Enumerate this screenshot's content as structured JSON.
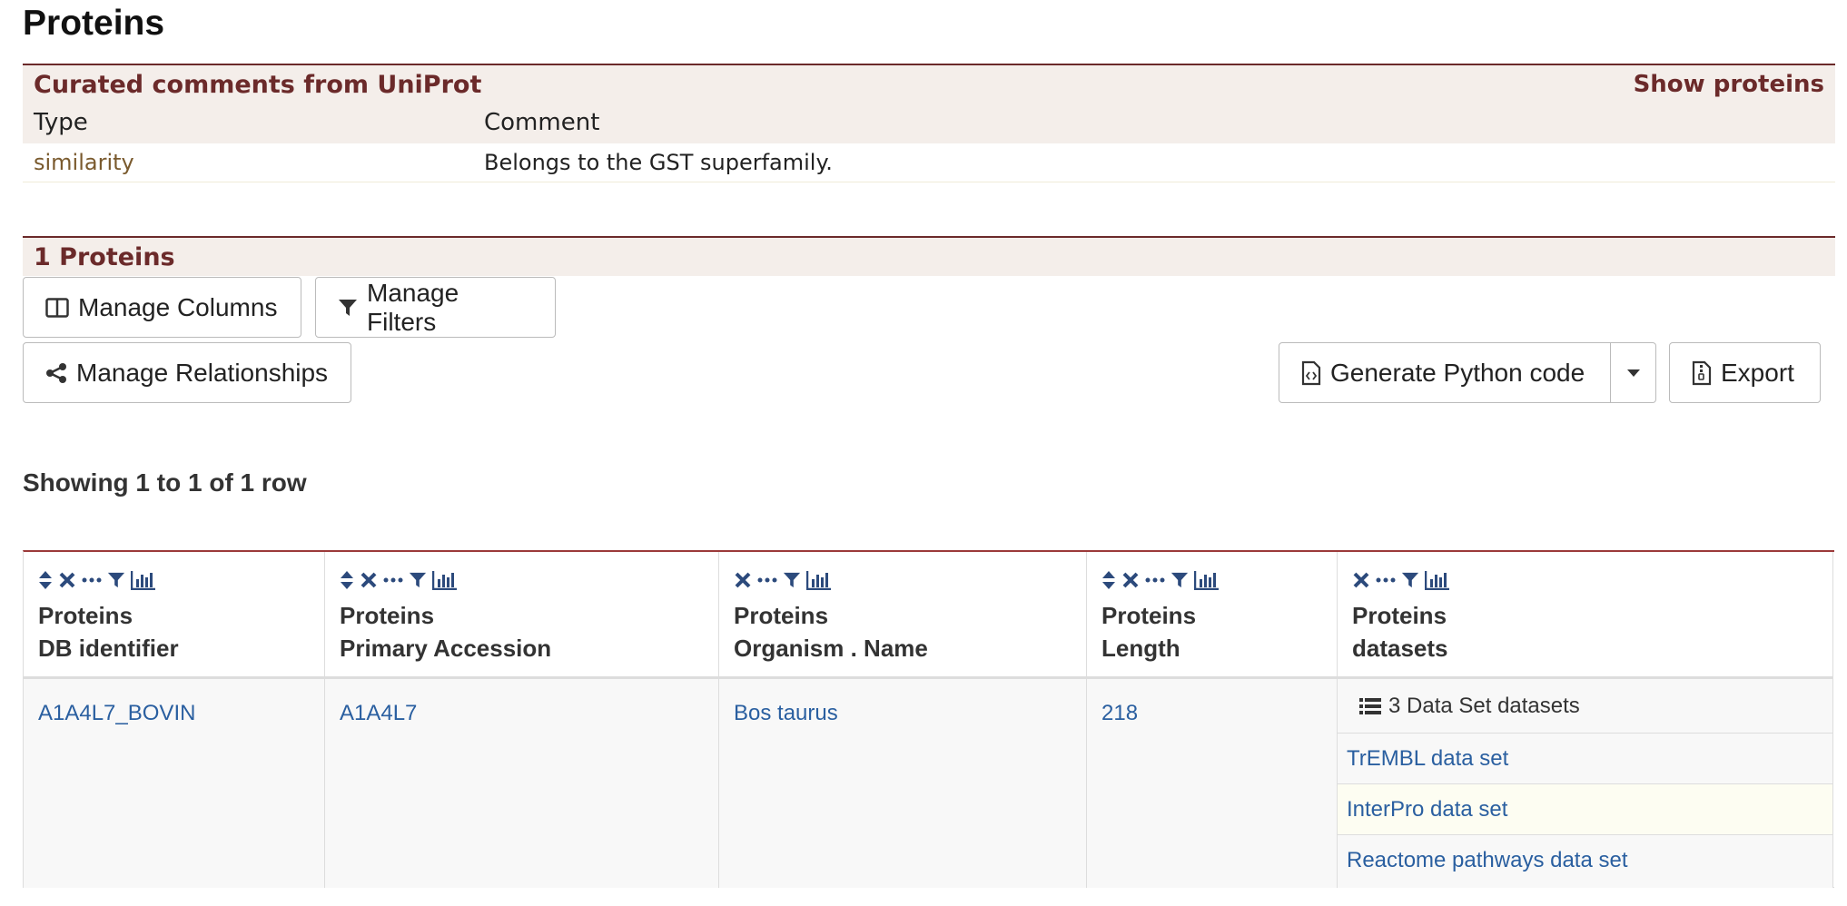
{
  "page_title": "Proteins",
  "comments": {
    "title": "Curated comments from UniProt",
    "show_label": "Show proteins",
    "columns": [
      "Type",
      "Comment"
    ],
    "rows": [
      {
        "type": "similarity",
        "comment": "Belongs to the GST superfamily."
      }
    ]
  },
  "proteins_section": {
    "title": "1 Proteins",
    "buttons": {
      "manage_columns": "Manage Columns",
      "manage_filters": "Manage Filters",
      "manage_relationships": "Manage Relationships",
      "generate_code": "Generate Python code",
      "export": "Export"
    },
    "showing": "Showing 1 to 1 of 1 row"
  },
  "table": {
    "columns": [
      {
        "line1": "Proteins",
        "line2": "DB identifier"
      },
      {
        "line1": "Proteins",
        "line2": "Primary Accession"
      },
      {
        "line1": "Proteins",
        "line2": "Organism . Name"
      },
      {
        "line1": "Proteins",
        "line2": "Length"
      },
      {
        "line1": "Proteins",
        "line2": "datasets"
      }
    ],
    "row": {
      "db_identifier": "A1A4L7_BOVIN",
      "primary_accession": "A1A4L7",
      "organism": "Bos taurus",
      "length": "218",
      "datasets_summary": "3 Data Set datasets",
      "datasets": [
        "TrEMBL data set",
        "InterPro data set",
        "Reactome pathways data set"
      ]
    }
  },
  "colors": {
    "accent": "#6b2a2a",
    "link": "#2a5fa0",
    "icon": "#2c4a7c"
  }
}
